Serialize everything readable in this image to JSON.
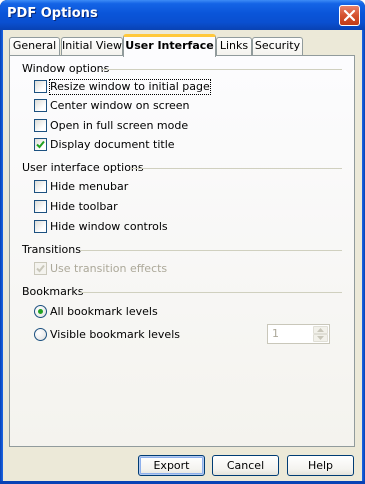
{
  "window": {
    "title": "PDF Options"
  },
  "tabs": [
    {
      "label": "General"
    },
    {
      "label": "Initial View"
    },
    {
      "label": "User Interface"
    },
    {
      "label": "Links"
    },
    {
      "label": "Security"
    }
  ],
  "active_tab": "User Interface",
  "window_options": {
    "heading": "Window options",
    "items": [
      {
        "label": "Resize window to initial page",
        "checked": false
      },
      {
        "label": "Center window on screen",
        "checked": false
      },
      {
        "label": "Open in full screen mode",
        "checked": false
      },
      {
        "label": "Display document title",
        "checked": true
      }
    ]
  },
  "ui_options": {
    "heading": "User interface options",
    "items": [
      {
        "label": "Hide menubar",
        "checked": false
      },
      {
        "label": "Hide toolbar",
        "checked": false
      },
      {
        "label": "Hide window controls",
        "checked": false
      }
    ]
  },
  "transitions": {
    "heading": "Transitions",
    "items": [
      {
        "label": "Use transition effects",
        "checked": true,
        "enabled": false
      }
    ]
  },
  "bookmarks": {
    "heading": "Bookmarks",
    "all_label": "All bookmark levels",
    "visible_label": "Visible bookmark levels",
    "selected": "All bookmark levels",
    "levels_value": "1"
  },
  "buttons": {
    "export": "Export",
    "cancel": "Cancel",
    "help": "Help"
  },
  "colors": {
    "titlebar": "#0a55d9",
    "active_tab_accent": "#ffc83c",
    "check": "#21a121"
  }
}
